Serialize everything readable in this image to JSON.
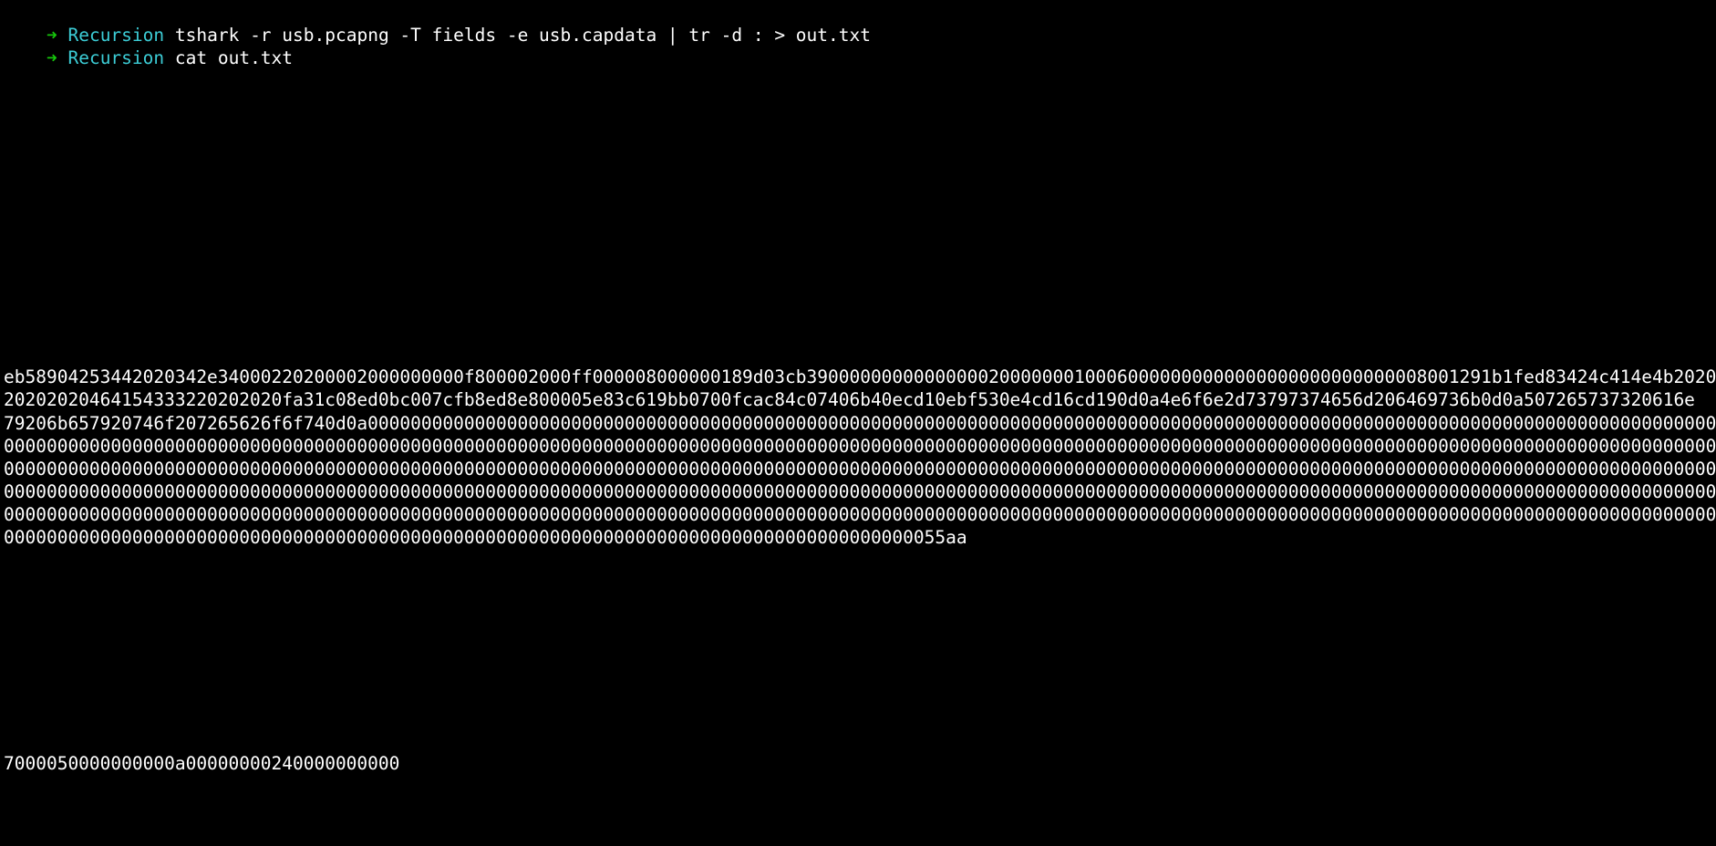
{
  "colors": {
    "background": "#000000",
    "prompt_arrow": "#16c60c",
    "prompt_dir": "#3ccdd6",
    "text": "#ffffff"
  },
  "prompt": {
    "arrow": "➜",
    "dir": "Recursion"
  },
  "commands": [
    "tshark -r usb.pcapng -T fields -e usb.capdata | tr -d : > out.txt",
    "cat out.txt"
  ],
  "output_lines": [
    "eb58904253442020342e34000220200002000000000f800002000ff000008000000189d03cb3900000000000000020000000100060000000000000000000000000008001291b1fed83424c414e4b2020",
    "20202020464154333220202020fa31c08ed0bc007cfb8ed8e800005e83c619bb0700fcac84c07406b40ecd10ebf530e4cd16cd190d0a4e6f6e2d73797374656d206469736b0d0a507265737320616e",
    "79206b657920746f207265626f6f740d0a000000000000000000000000000000000000000000000000000000000000000000000000000000000000000000000000000000000000000000000000000000",
    "000000000000000000000000000000000000000000000000000000000000000000000000000000000000000000000000000000000000000000000000000000000000000000000000000000000000000000",
    "000000000000000000000000000000000000000000000000000000000000000000000000000000000000000000000000000000000000000000000000000000000000000000000000000000000000000000",
    "000000000000000000000000000000000000000000000000000000000000000000000000000000000000000000000000000000000000000000000000000000000000000000000000000000000000000000",
    "000000000000000000000000000000000000000000000000000000000000000000000000000000000000000000000000000000000000000000000000000000000000000000000000000000000000000000",
    "0000000000000000000000000000000000000000000000000000000000000000000000000000000000000055aa",
    "7000050000000000a00000000240000000000"
  ]
}
